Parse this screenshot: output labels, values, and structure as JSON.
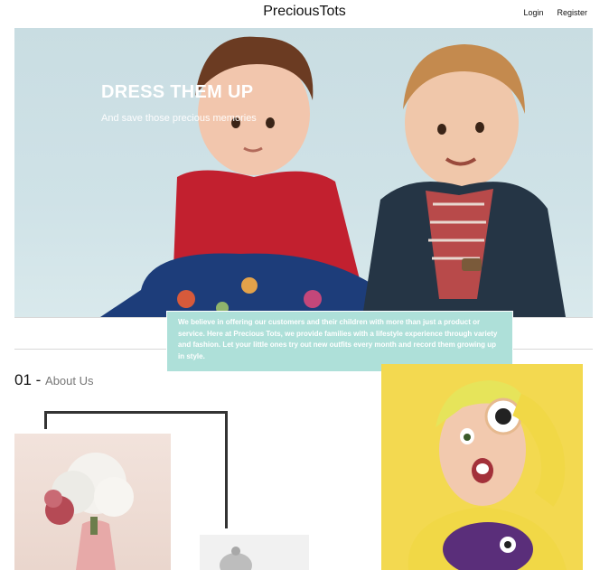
{
  "header": {
    "brand": "PreciousTots",
    "nav": {
      "login": "Login",
      "register": "Register"
    }
  },
  "hero": {
    "title": "DRESS THEM UP",
    "subtitle": "And save those precious memories"
  },
  "about_text": "We believe in offering our customers and their children with more than just a product or service. Here at Precious Tots, we provide families with a lifestyle experience through variety and fashion. Let your little ones try out new outfits every month and record them growing up in style.",
  "section": {
    "number": "01 -",
    "title": "About Us"
  },
  "colors": {
    "accent_teal": "#aee0d9",
    "hero_bg": "#cfe2e7",
    "kid_bg": "#f3d950"
  }
}
